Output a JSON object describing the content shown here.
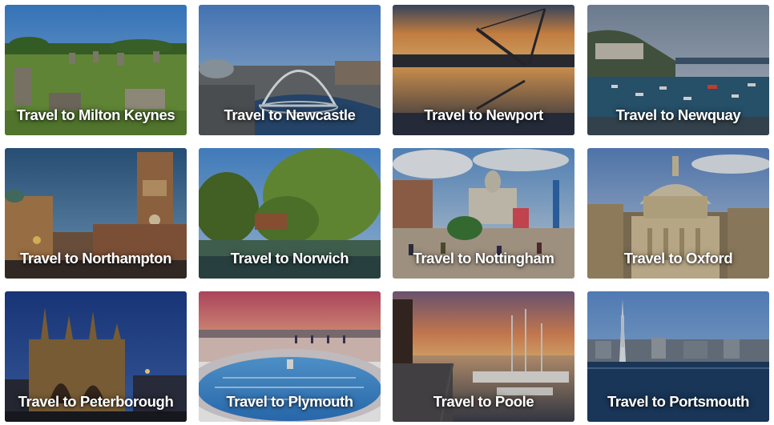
{
  "destinations": [
    {
      "label": "Travel to Milton Keynes"
    },
    {
      "label": "Travel to Newcastle"
    },
    {
      "label": "Travel to Newport"
    },
    {
      "label": "Travel to Newquay"
    },
    {
      "label": "Travel to Northampton"
    },
    {
      "label": "Travel to Norwich"
    },
    {
      "label": "Travel to Nottingham"
    },
    {
      "label": "Travel to Oxford"
    },
    {
      "label": "Travel to Peterborough"
    },
    {
      "label": "Travel to Plymouth"
    },
    {
      "label": "Travel to Poole"
    },
    {
      "label": "Travel to Portsmouth"
    }
  ]
}
